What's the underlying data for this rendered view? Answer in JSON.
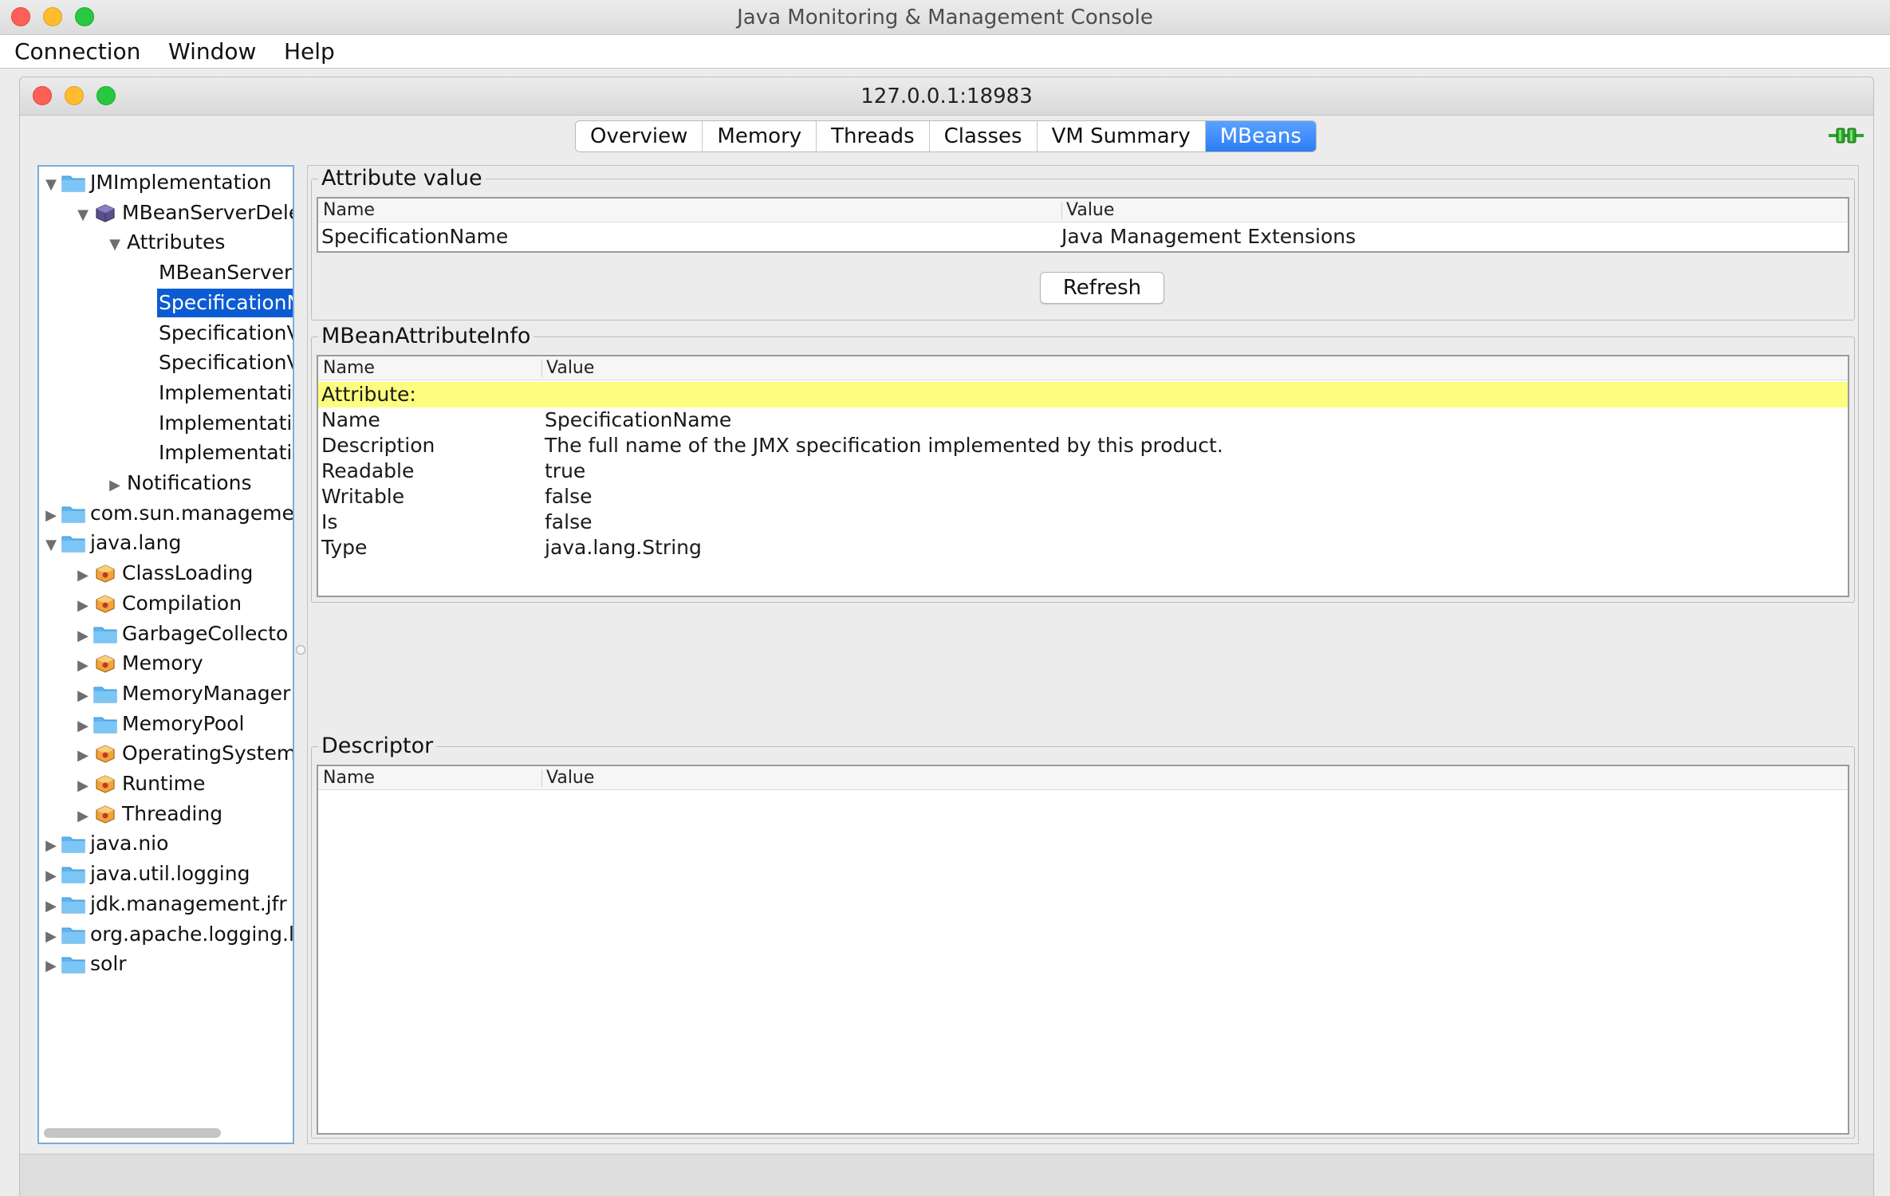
{
  "window": {
    "title": "Java Monitoring & Management Console"
  },
  "menu": {
    "items": [
      "Connection",
      "Window",
      "Help"
    ]
  },
  "connection": {
    "title": "127.0.0.1:18983"
  },
  "tabs": [
    {
      "label": "Overview"
    },
    {
      "label": "Memory"
    },
    {
      "label": "Threads"
    },
    {
      "label": "Classes"
    },
    {
      "label": "VM Summary"
    },
    {
      "label": "MBeans",
      "active": true
    }
  ],
  "tree": [
    {
      "label": "JMImplementation",
      "toggle": "expanded",
      "icon": "folder-icon",
      "level": 0
    },
    {
      "label": "MBeanServerDele",
      "toggle": "expanded",
      "icon": "mbean-cube-icon",
      "level": 1
    },
    {
      "label": "Attributes",
      "toggle": "expanded",
      "icon": "",
      "level": 2
    },
    {
      "label": "MBeanServerI",
      "toggle": "",
      "icon": "",
      "level": 3
    },
    {
      "label": "SpecificationN",
      "toggle": "",
      "icon": "",
      "level": 3,
      "selected": true
    },
    {
      "label": "SpecificationV",
      "toggle": "",
      "icon": "",
      "level": 3
    },
    {
      "label": "SpecificationV",
      "toggle": "",
      "icon": "",
      "level": 3
    },
    {
      "label": "Implementati",
      "toggle": "",
      "icon": "",
      "level": 3
    },
    {
      "label": "Implementati",
      "toggle": "",
      "icon": "",
      "level": 3
    },
    {
      "label": "Implementati",
      "toggle": "",
      "icon": "",
      "level": 3
    },
    {
      "label": "Notifications",
      "toggle": "collapsed",
      "icon": "",
      "level": 2
    },
    {
      "label": "com.sun.manageme",
      "toggle": "collapsed",
      "icon": "folder-icon",
      "level": 0
    },
    {
      "label": "java.lang",
      "toggle": "expanded",
      "icon": "folder-icon",
      "level": 0
    },
    {
      "label": "ClassLoading",
      "toggle": "collapsed",
      "icon": "bean-icon",
      "level": 1
    },
    {
      "label": "Compilation",
      "toggle": "collapsed",
      "icon": "bean-icon",
      "level": 1
    },
    {
      "label": "GarbageCollecto",
      "toggle": "collapsed",
      "icon": "folder-icon",
      "level": 1
    },
    {
      "label": "Memory",
      "toggle": "collapsed",
      "icon": "bean-icon",
      "level": 1
    },
    {
      "label": "MemoryManager",
      "toggle": "collapsed",
      "icon": "folder-icon",
      "level": 1
    },
    {
      "label": "MemoryPool",
      "toggle": "collapsed",
      "icon": "folder-icon",
      "level": 1
    },
    {
      "label": "OperatingSystem",
      "toggle": "collapsed",
      "icon": "bean-icon",
      "level": 1
    },
    {
      "label": "Runtime",
      "toggle": "collapsed",
      "icon": "bean-icon",
      "level": 1
    },
    {
      "label": "Threading",
      "toggle": "collapsed",
      "icon": "bean-icon",
      "level": 1
    },
    {
      "label": "java.nio",
      "toggle": "collapsed",
      "icon": "folder-icon",
      "level": 0
    },
    {
      "label": "java.util.logging",
      "toggle": "collapsed",
      "icon": "folder-icon",
      "level": 0
    },
    {
      "label": "jdk.management.jfr",
      "toggle": "collapsed",
      "icon": "folder-icon",
      "level": 0
    },
    {
      "label": "org.apache.logging.l",
      "toggle": "collapsed",
      "icon": "folder-icon",
      "level": 0
    },
    {
      "label": "solr",
      "toggle": "collapsed",
      "icon": "folder-icon",
      "level": 0
    }
  ],
  "attribute_value": {
    "legend": "Attribute value",
    "columns": [
      "Name",
      "Value"
    ],
    "rows": [
      {
        "name": "SpecificationName",
        "value": "Java Management Extensions"
      }
    ],
    "refresh_label": "Refresh"
  },
  "mbean_attribute_info": {
    "legend": "MBeanAttributeInfo",
    "columns": [
      "Name",
      "Value"
    ],
    "section_label": "Attribute:",
    "rows": [
      {
        "name": "Name",
        "value": "SpecificationName"
      },
      {
        "name": "Description",
        "value": "The full name of the JMX specification implemented by this product."
      },
      {
        "name": "Readable",
        "value": "true"
      },
      {
        "name": "Writable",
        "value": "false"
      },
      {
        "name": "Is",
        "value": "false"
      },
      {
        "name": "Type",
        "value": "java.lang.String"
      }
    ]
  },
  "descriptor": {
    "legend": "Descriptor",
    "columns": [
      "Name",
      "Value"
    ]
  },
  "colors": {
    "accent": "#2c7df7",
    "selection": "#0b5bd3",
    "highlight_row": "#fdfd80",
    "folder": "#5fb4f0",
    "connected": "#2aa52a"
  }
}
